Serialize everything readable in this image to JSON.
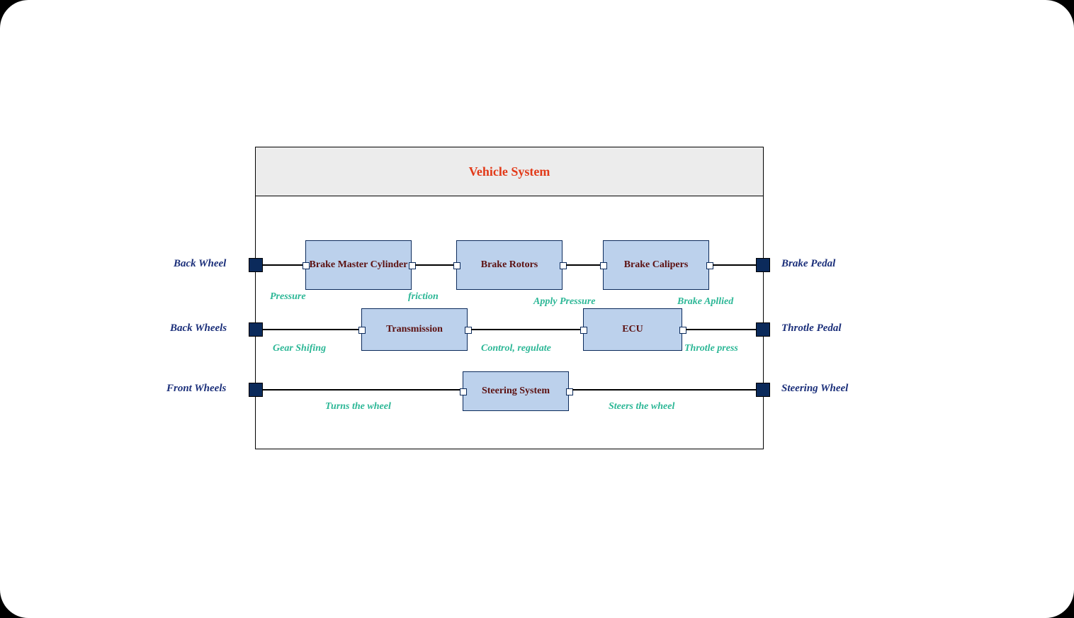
{
  "title": "Vehicle System",
  "blocks": {
    "brake_master": "Brake Master Cylinder",
    "brake_rotors": "Brake Rotors",
    "brake_calipers": "Brake Calipers",
    "transmission": "Transmission",
    "ecu": "ECU",
    "steering": "Steering System"
  },
  "external_ports": {
    "back_wheel": "Back Wheel",
    "back_wheels": "Back Wheels",
    "front_wheels": "Front Wheels",
    "brake_pedal": "Brake Pedal",
    "throttle_pedal": "Throtle Pedal",
    "steering_wheel": "Steering Wheel"
  },
  "flows": {
    "pressure": "Pressure",
    "friction": "friction",
    "apply_pressure": "Apply Pressure",
    "brake_applied": "Brake Apllied",
    "gear_shifting": "Gear Shifing",
    "control_regulate": "Control, regulate",
    "throttle_press": "Throtle press",
    "turns_wheel": "Turns  the wheel",
    "steers_wheel": "Steers the wheel"
  }
}
